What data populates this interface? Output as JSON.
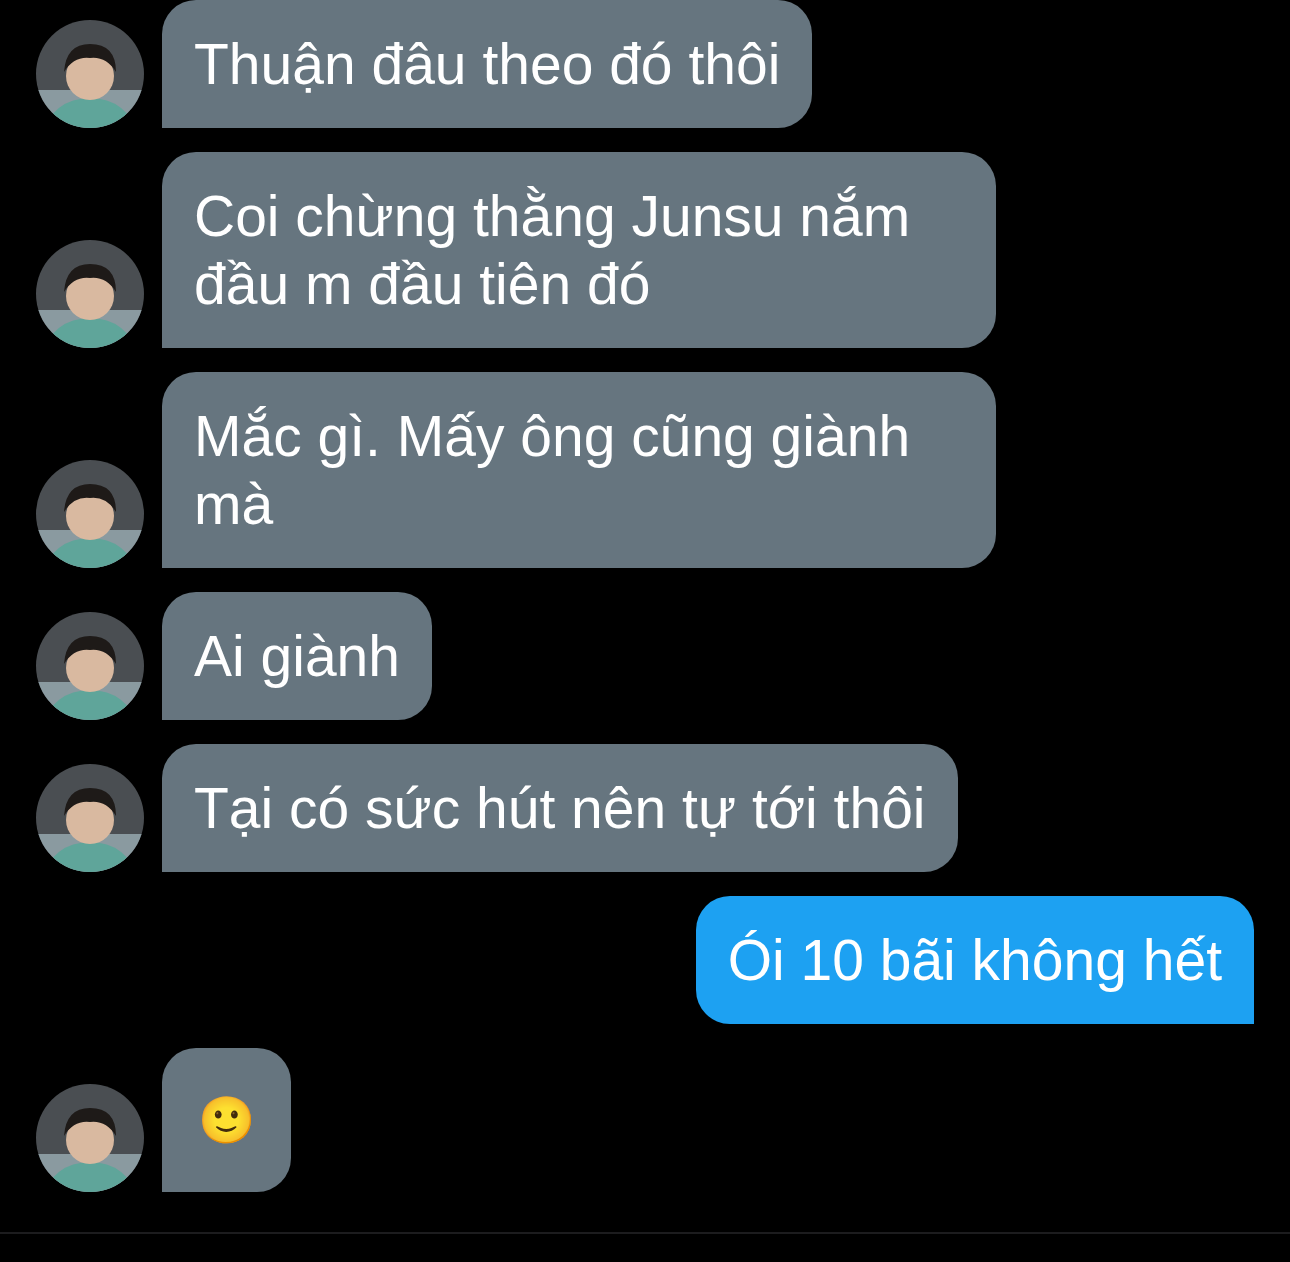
{
  "messages": [
    {
      "outgoing": false,
      "text": "Thuận đâu theo đó thôi"
    },
    {
      "outgoing": false,
      "text": "Coi chừng thằng Junsu nắm đầu m đầu tiên đó"
    },
    {
      "outgoing": false,
      "text": "Mắc gì. Mấy ông cũng giành mà"
    },
    {
      "outgoing": false,
      "text": "Ai giành"
    },
    {
      "outgoing": false,
      "text": "Tại có sức hút nên tự tới thôi"
    },
    {
      "outgoing": true,
      "text": "Ói 10 bãi không hết"
    },
    {
      "outgoing": false,
      "text": "🙂",
      "kind": "emoji"
    }
  ]
}
